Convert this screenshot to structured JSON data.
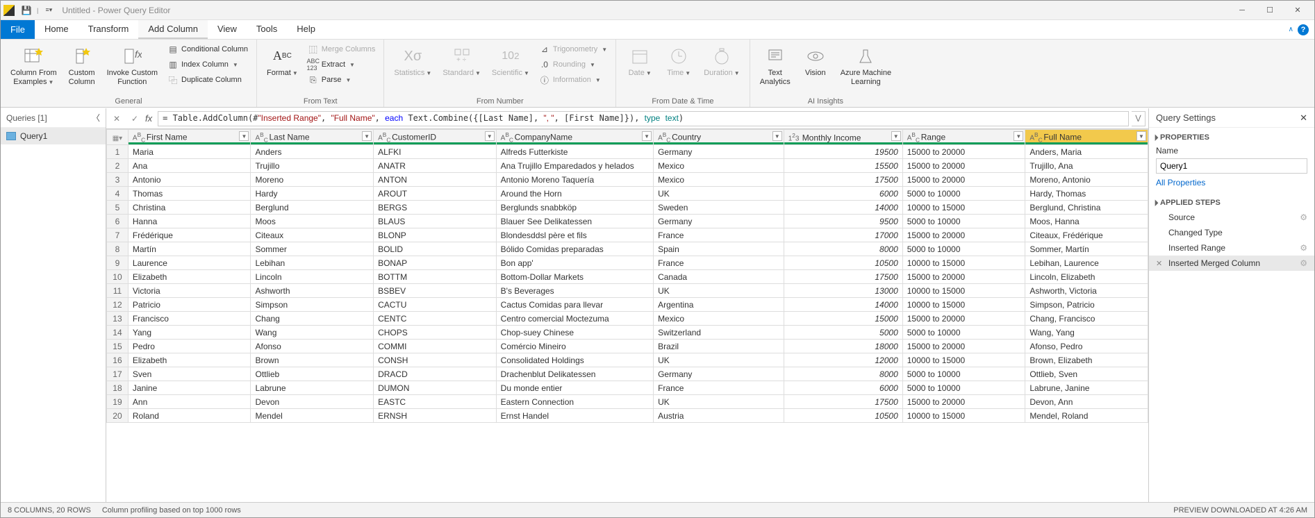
{
  "title": "Untitled - Power Query Editor",
  "menu": {
    "file": "File",
    "home": "Home",
    "transform": "Transform",
    "addcolumn": "Add Column",
    "view": "View",
    "tools": "Tools",
    "help": "Help"
  },
  "ribbon": {
    "general": {
      "col_from_examples": "Column From\nExamples",
      "custom_column": "Custom\nColumn",
      "invoke": "Invoke Custom\nFunction",
      "conditional": "Conditional Column",
      "index": "Index Column",
      "duplicate": "Duplicate Column",
      "label": "General"
    },
    "from_text": {
      "format": "Format",
      "merge": "Merge Columns",
      "extract": "Extract",
      "parse": "Parse",
      "label": "From Text"
    },
    "from_number": {
      "statistics": "Statistics",
      "standard": "Standard",
      "scientific": "Scientific",
      "trig": "Trigonometry",
      "rounding": "Rounding",
      "info": "Information",
      "label": "From Number"
    },
    "datetime": {
      "date": "Date",
      "time": "Time",
      "duration": "Duration",
      "label": "From Date & Time"
    },
    "ai": {
      "text": "Text\nAnalytics",
      "vision": "Vision",
      "aml": "Azure Machine\nLearning",
      "label": "AI Insights"
    }
  },
  "queries": {
    "header": "Queries [1]",
    "item": "Query1"
  },
  "formula_display": "= Table.AddColumn(#\"Inserted Range\", \"Full Name\", each Text.Combine({[Last Name], \", \", [First Name]}), type text)",
  "columns": [
    {
      "name": "First Name",
      "type": "ABC"
    },
    {
      "name": "Last Name",
      "type": "ABC"
    },
    {
      "name": "CustomerID",
      "type": "ABC"
    },
    {
      "name": "CompanyName",
      "type": "ABC"
    },
    {
      "name": "Country",
      "type": "ABC"
    },
    {
      "name": "Monthly Income",
      "type": "123"
    },
    {
      "name": "Range",
      "type": "ABC"
    },
    {
      "name": "Full Name",
      "type": "ABC",
      "merged": true
    }
  ],
  "rows": [
    [
      "Maria",
      "Anders",
      "ALFKI",
      "Alfreds Futterkiste",
      "Germany",
      "19500",
      "15000 to 20000",
      "Anders, Maria"
    ],
    [
      "Ana",
      "Trujillo",
      "ANATR",
      "Ana Trujillo Emparedados y helados",
      "Mexico",
      "15500",
      "15000 to 20000",
      "Trujillo, Ana"
    ],
    [
      "Antonio",
      "Moreno",
      "ANTON",
      "Antonio Moreno Taquería",
      "Mexico",
      "17500",
      "15000 to 20000",
      "Moreno, Antonio"
    ],
    [
      "Thomas",
      "Hardy",
      "AROUT",
      "Around the Horn",
      "UK",
      "6000",
      "5000 to 10000",
      "Hardy, Thomas"
    ],
    [
      "Christina",
      "Berglund",
      "BERGS",
      "Berglunds snabbköp",
      "Sweden",
      "14000",
      "10000 to 15000",
      "Berglund, Christina"
    ],
    [
      "Hanna",
      "Moos",
      "BLAUS",
      "Blauer See Delikatessen",
      "Germany",
      "9500",
      "5000 to 10000",
      "Moos, Hanna"
    ],
    [
      "Frédérique",
      "Citeaux",
      "BLONP",
      "Blondesddsl père et fils",
      "France",
      "17000",
      "15000 to 20000",
      "Citeaux, Frédérique"
    ],
    [
      "Martín",
      "Sommer",
      "BOLID",
      "Bólido Comidas preparadas",
      "Spain",
      "8000",
      "5000 to 10000",
      "Sommer, Martín"
    ],
    [
      "Laurence",
      "Lebihan",
      "BONAP",
      "Bon app'",
      "France",
      "10500",
      "10000 to 15000",
      "Lebihan, Laurence"
    ],
    [
      "Elizabeth",
      "Lincoln",
      "BOTTM",
      "Bottom-Dollar Markets",
      "Canada",
      "17500",
      "15000 to 20000",
      "Lincoln, Elizabeth"
    ],
    [
      "Victoria",
      "Ashworth",
      "BSBEV",
      "B's Beverages",
      "UK",
      "13000",
      "10000 to 15000",
      "Ashworth, Victoria"
    ],
    [
      "Patricio",
      "Simpson",
      "CACTU",
      "Cactus Comidas para llevar",
      "Argentina",
      "14000",
      "10000 to 15000",
      "Simpson, Patricio"
    ],
    [
      "Francisco",
      "Chang",
      "CENTC",
      "Centro comercial Moctezuma",
      "Mexico",
      "15000",
      "15000 to 20000",
      "Chang, Francisco"
    ],
    [
      "Yang",
      "Wang",
      "CHOPS",
      "Chop-suey Chinese",
      "Switzerland",
      "5000",
      "5000 to 10000",
      "Wang, Yang"
    ],
    [
      "Pedro",
      "Afonso",
      "COMMI",
      "Comércio Mineiro",
      "Brazil",
      "18000",
      "15000 to 20000",
      "Afonso, Pedro"
    ],
    [
      "Elizabeth",
      "Brown",
      "CONSH",
      "Consolidated Holdings",
      "UK",
      "12000",
      "10000 to 15000",
      "Brown, Elizabeth"
    ],
    [
      "Sven",
      "Ottlieb",
      "DRACD",
      "Drachenblut Delikatessen",
      "Germany",
      "8000",
      "5000 to 10000",
      "Ottlieb, Sven"
    ],
    [
      "Janine",
      "Labrune",
      "DUMON",
      "Du monde entier",
      "France",
      "6000",
      "5000 to 10000",
      "Labrune, Janine"
    ],
    [
      "Ann",
      "Devon",
      "EASTC",
      "Eastern Connection",
      "UK",
      "17500",
      "15000 to 20000",
      "Devon, Ann"
    ],
    [
      "Roland",
      "Mendel",
      "ERNSH",
      "Ernst Handel",
      "Austria",
      "10500",
      "10000 to 15000",
      "Mendel, Roland"
    ]
  ],
  "settings": {
    "header": "Query Settings",
    "properties": "PROPERTIES",
    "name_label": "Name",
    "name_value": "Query1",
    "all_props": "All Properties",
    "applied": "APPLIED STEPS",
    "steps": [
      {
        "label": "Source",
        "gear": true
      },
      {
        "label": "Changed Type",
        "gear": false
      },
      {
        "label": "Inserted Range",
        "gear": true
      },
      {
        "label": "Inserted Merged Column",
        "gear": true,
        "selected": true,
        "x": true
      }
    ]
  },
  "status": {
    "left": "8 COLUMNS, 20 ROWS",
    "mid": "Column profiling based on top 1000 rows",
    "right": "PREVIEW DOWNLOADED AT 4:26 AM"
  }
}
